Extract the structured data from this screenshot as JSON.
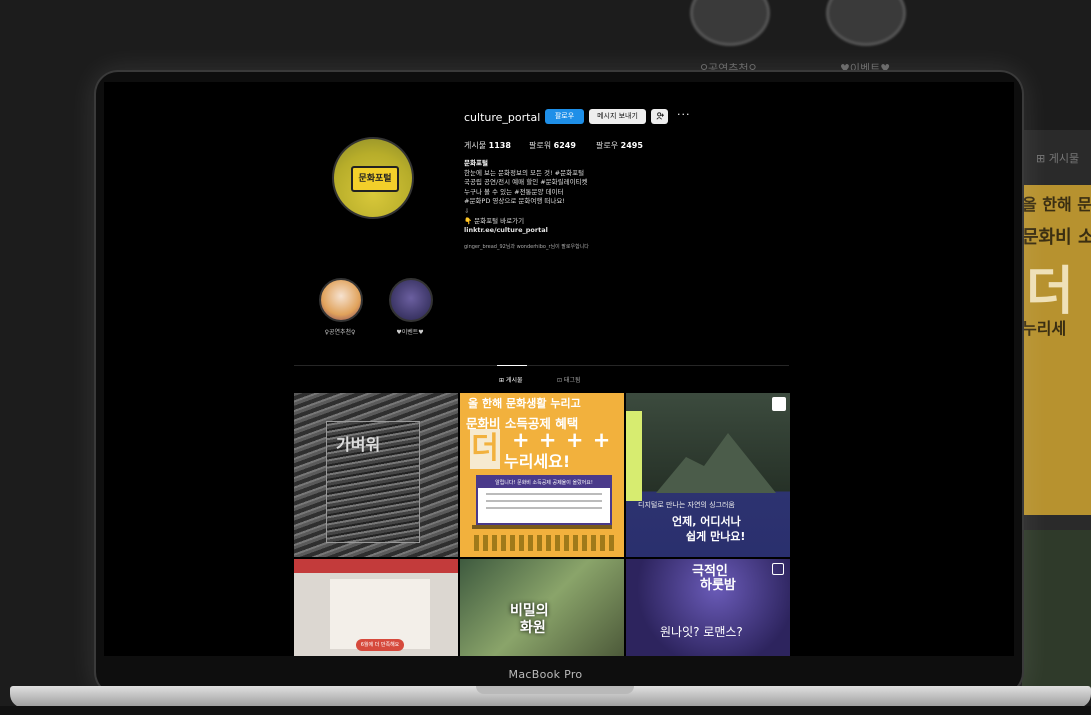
{
  "background": {
    "highlight_labels": [
      "♀공연추천♀",
      "♥이벤트♥"
    ],
    "tab_label": "⊞ 게시물",
    "poster_lines": [
      "올 한해 문",
      "문화비 소",
      "더",
      "누리세"
    ]
  },
  "profile": {
    "username": "culture_portal",
    "follow_button": "팔로우",
    "message_button": "메시지 보내기",
    "add_person_icon": "person-add-icon",
    "more_icon": "···",
    "stats": [
      {
        "label": "게시물",
        "value": "1138"
      },
      {
        "label": "팔로워",
        "value": "6249"
      },
      {
        "label": "팔로우",
        "value": "2495"
      }
    ],
    "bio_name": "문화포털",
    "bio_lines": [
      "한눈에 보는 문화정보의 모든 것! #문화포털",
      "국공립 공연/전시 예매 할인 #문화릴레이티켓",
      "누구나 볼 수 있는 #전통문양 데이터",
      "#문화PD 영상으로 문화여행 떠나요!"
    ],
    "arrow": "⇓",
    "shortcut": "👇 문화포털 바로가기",
    "link": "linktr.ee/culture_portal",
    "followed_by": "ginger_bread_92님과 wonderhibo_r님이 팔로우합니다"
  },
  "highlights": [
    {
      "label": "♀공연추천♀"
    },
    {
      "label": "♥이벤트♥"
    }
  ],
  "tabs": [
    {
      "label": "⊞ 게시물",
      "active": true
    },
    {
      "label": "⊡ 태그됨",
      "active": false
    }
  ],
  "posts": [
    {
      "text": "가벼워"
    },
    {
      "lines": [
        "올 한해 문화생활 누리고",
        "문화비 소득공제 혜택",
        "+ + + +",
        "더",
        "누리세요!"
      ],
      "box_header": "알립니다! 문화비 소득공제 공제율이 올랐어요!"
    },
    {
      "lines": [
        "디지털로 만나는 자연의 싱그러움",
        "언제, 어디서나",
        "쉽게 만나요!"
      ]
    },
    {
      "pill": "6월에 더 만족해요"
    },
    {
      "lines": [
        "비밀의",
        "화원"
      ]
    },
    {
      "lines": [
        "극적인",
        "하룻밤"
      ],
      "sub": "원나잇? 로맨스?"
    }
  ],
  "laptop_label": "MacBook Pro",
  "colors": {
    "accent": "#1e8fe8",
    "background": "#000000"
  }
}
